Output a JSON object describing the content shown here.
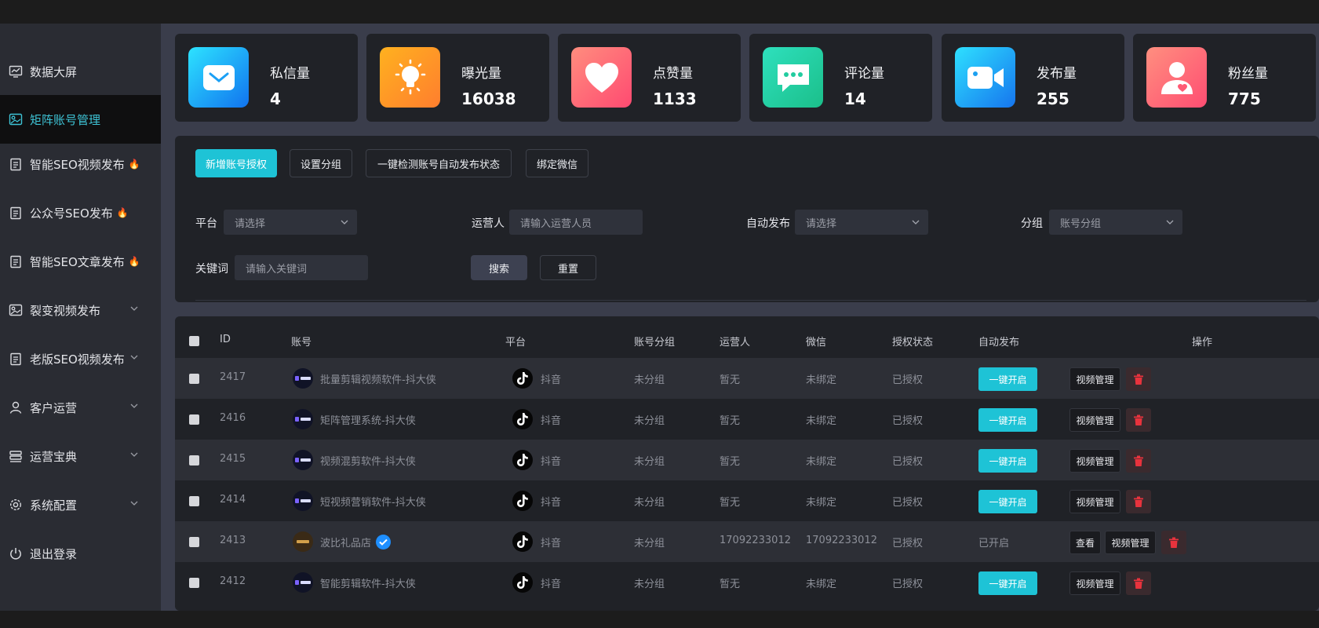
{
  "sidebar": {
    "items": [
      {
        "label": "数据大屏"
      },
      {
        "label": "矩阵账号管理"
      },
      {
        "label": "智能SEO视频发布"
      },
      {
        "label": "公众号SEO发布"
      },
      {
        "label": "智能SEO文章发布"
      },
      {
        "label": "裂变视频发布"
      },
      {
        "label": "老版SEO视频发布"
      },
      {
        "label": "客户运营"
      },
      {
        "label": "运营宝典"
      },
      {
        "label": "系统配置"
      },
      {
        "label": "退出登录"
      }
    ]
  },
  "stats": [
    {
      "label": "私信量",
      "value": "4",
      "icon": "mail-icon"
    },
    {
      "label": "曝光量",
      "value": "16038",
      "icon": "bulb-icon"
    },
    {
      "label": "点赞量",
      "value": "1133",
      "icon": "heart-icon"
    },
    {
      "label": "评论量",
      "value": "14",
      "icon": "comment-icon"
    },
    {
      "label": "发布量",
      "value": "255",
      "icon": "video-camera-icon"
    },
    {
      "label": "粉丝量",
      "value": "775",
      "icon": "user-icon"
    }
  ],
  "actions": {
    "add_auth": "新增账号授权",
    "set_group": "设置分组",
    "check_status": "一键检测账号自动发布状态",
    "bind_wechat": "绑定微信"
  },
  "filters": {
    "platform_label": "平台",
    "platform_placeholder": "请选择",
    "operator_label": "运营人",
    "operator_placeholder": "请输入运营人员",
    "auto_label": "自动发布",
    "auto_placeholder": "请选择",
    "group_label": "分组",
    "group_placeholder": "账号分组",
    "keyword_label": "关键词",
    "keyword_placeholder": "请输入关键词",
    "search": "搜索",
    "reset": "重置"
  },
  "table": {
    "headers": {
      "id": "ID",
      "account": "账号",
      "platform": "平台",
      "group": "账号分组",
      "operator": "运营人",
      "wechat": "微信",
      "auth": "授权状态",
      "auto": "自动发布",
      "ops": "操作"
    },
    "rows": [
      {
        "id": "2417",
        "account": "批量剪辑视频软件-抖大侠",
        "platform": "抖音",
        "group": "未分组",
        "operator": "暂无",
        "wechat": "未绑定",
        "auth": "已授权",
        "auto": "一键开启",
        "video_mgmt": "视频管理"
      },
      {
        "id": "2416",
        "account": "矩阵管理系统-抖大侠",
        "platform": "抖音",
        "group": "未分组",
        "operator": "暂无",
        "wechat": "未绑定",
        "auth": "已授权",
        "auto": "一键开启",
        "video_mgmt": "视频管理"
      },
      {
        "id": "2415",
        "account": "视频混剪软件-抖大侠",
        "platform": "抖音",
        "group": "未分组",
        "operator": "暂无",
        "wechat": "未绑定",
        "auth": "已授权",
        "auto": "一键开启",
        "video_mgmt": "视频管理"
      },
      {
        "id": "2414",
        "account": "短视频营销软件-抖大侠",
        "platform": "抖音",
        "group": "未分组",
        "operator": "暂无",
        "wechat": "未绑定",
        "auth": "已授权",
        "auto": "一键开启",
        "video_mgmt": "视频管理"
      },
      {
        "id": "2413",
        "account": "波比礼品店",
        "platform": "抖音",
        "group": "未分组",
        "operator": "17092233012",
        "wechat": "17092233012",
        "auth": "已授权",
        "auto_status": "已开启",
        "view": "查看",
        "video_mgmt": "视频管理"
      },
      {
        "id": "2412",
        "account": "智能剪辑软件-抖大侠",
        "platform": "抖音",
        "group": "未分组",
        "operator": "暂无",
        "wechat": "未绑定",
        "auth": "已授权",
        "auto": "一键开启",
        "video_mgmt": "视频管理"
      }
    ]
  },
  "colors": {
    "accent": "#1ec3d6",
    "sidebar_active_text": "#3ec3d5",
    "delete_icon": "#e8333d",
    "fire_icon": "#ff7a3d"
  }
}
